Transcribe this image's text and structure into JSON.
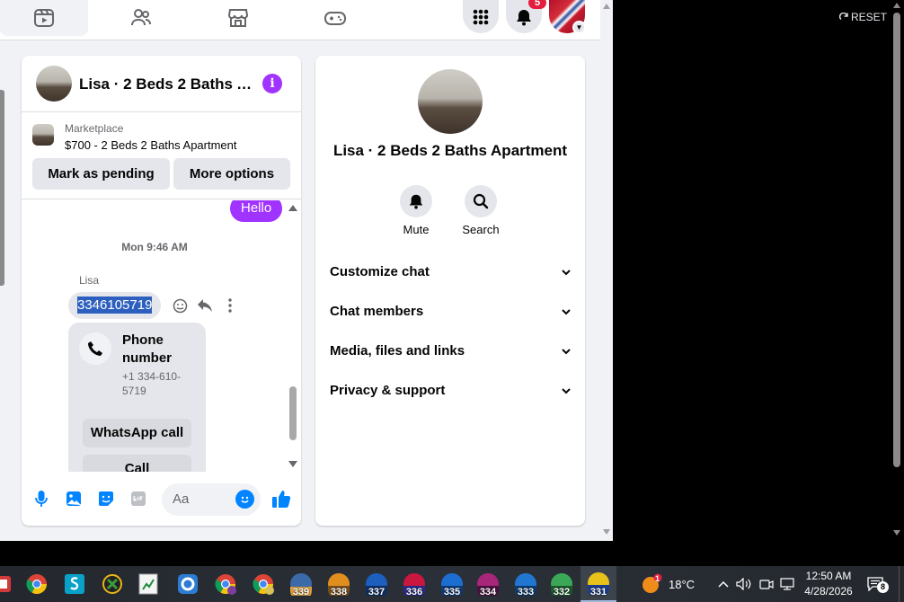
{
  "nav": {
    "tabs": [
      {
        "name": "video-tab",
        "icon": "video-icon"
      },
      {
        "name": "friends-tab",
        "icon": "friends-icon"
      },
      {
        "name": "marketplace-tab",
        "icon": "marketplace-icon"
      },
      {
        "name": "gaming-tab",
        "icon": "gaming-icon"
      }
    ],
    "notification_count": "5"
  },
  "chat": {
    "title": "Lisa · 2 Beds 2 Baths Apartment",
    "marketplace_label": "Marketplace",
    "listing_price_title": "$700 - 2 Beds 2 Baths Apartment",
    "mark_pending_label": "Mark as pending",
    "more_options_label": "More options",
    "messages": {
      "outgoing_text": "Hello",
      "timestamp": "Mon 9:46 AM",
      "sender": "Lisa",
      "phone_text": "3346105719",
      "card": {
        "title": "Phone number",
        "subtitle": "+1 334-610-5719",
        "whatsapp_label": "WhatsApp call",
        "call_label": "Call"
      }
    },
    "composer": {
      "placeholder": "Aa"
    }
  },
  "info": {
    "title": "Lisa · 2 Beds 2 Baths Apartment",
    "actions": [
      {
        "label": "Mute",
        "icon": "bell-icon"
      },
      {
        "label": "Search",
        "icon": "search-icon"
      }
    ],
    "sections": [
      {
        "label": "Customize chat"
      },
      {
        "label": "Chat members"
      },
      {
        "label": "Media, files and links"
      },
      {
        "label": "Privacy & support"
      }
    ]
  },
  "side": {
    "reset_label": "RESET"
  },
  "taskbar": {
    "tab_numbers": [
      "339",
      "338",
      "337",
      "336",
      "335",
      "334",
      "333",
      "332",
      "331"
    ],
    "weather_badge": "1",
    "temperature": "18°C",
    "time": "12:50 AM",
    "date": "4/28/2026",
    "notification_count": "8"
  },
  "colors": {
    "accent": "#a033ff",
    "messenger_blue": "#0084ff",
    "selection": "#2c5fbe",
    "badge_red": "#e41e3f"
  }
}
